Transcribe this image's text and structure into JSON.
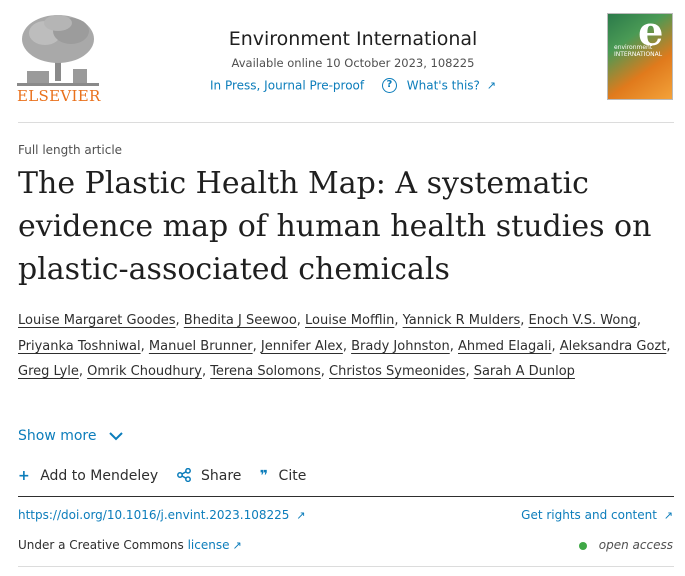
{
  "header": {
    "publisher": "ELSEVIER",
    "journal_title": "Environment International",
    "availability": "Available online 10 October 2023, 108225",
    "status_link": "In Press, Journal Pre-proof",
    "whats_this": "What's this?",
    "cover_letter": "e",
    "cover_text": "environment INTERNATIONAL"
  },
  "article": {
    "type": "Full length article",
    "title": "The Plastic Health Map: A systematic evidence map of human health studies on plastic-associated chemicals",
    "authors": [
      "Louise Margaret Goodes",
      "Bhedita J Seewoo",
      "Louise Mofflin",
      "Yannick R Mulders",
      "Enoch V.S. Wong",
      "Priyanka Toshniwal",
      "Manuel Brunner",
      "Jennifer Alex",
      "Brady Johnston",
      "Ahmed Elagali",
      "Aleksandra Gozt",
      "Greg Lyle",
      "Omrik Choudhury",
      "Terena Solomons",
      "Christos Symeonides",
      "Sarah A Dunlop"
    ],
    "show_more": "Show more"
  },
  "actions": {
    "mendeley": "Add to Mendeley",
    "share": "Share",
    "cite": "Cite"
  },
  "links": {
    "doi": "https://doi.org/10.1016/j.envint.2023.108225",
    "rights": "Get rights and content",
    "license_prefix": "Under a Creative Commons",
    "license_link": "license",
    "open_access": "open access"
  },
  "colors": {
    "accent": "#0c7dbb",
    "publisher_orange": "#e9711c",
    "open_access_green": "#3fa846"
  }
}
